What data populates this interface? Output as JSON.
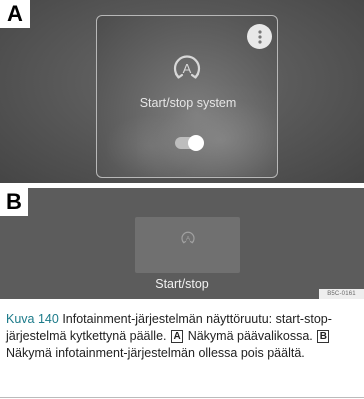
{
  "panel_a": {
    "letter": "A",
    "card": {
      "title": "Start/stop system",
      "icon": "start-stop-icon",
      "more_icon": "more-vertical-icon",
      "toggle": {
        "state": "on"
      }
    }
  },
  "panel_b": {
    "letter": "B",
    "card": {
      "icon": "start-stop-icon",
      "title": "Start/stop"
    }
  },
  "ref_code": "B5C-0161",
  "caption": {
    "fig_label": "Kuva 140",
    "text_1": "Infotainment-järjestelmän näyttöruutu: start-stop-järjestelmä kytkettynä päälle.",
    "ref_a": "A",
    "text_2": "Näkymä päävalikossa.",
    "ref_b": "B",
    "text_3": "Näkymä infotainment-järjestelmän ollessa pois päältä."
  },
  "colors": {
    "fig_label": "#1b7a89",
    "panel_bg": "#5c5c5c",
    "card_border": "#b8b8b8"
  }
}
